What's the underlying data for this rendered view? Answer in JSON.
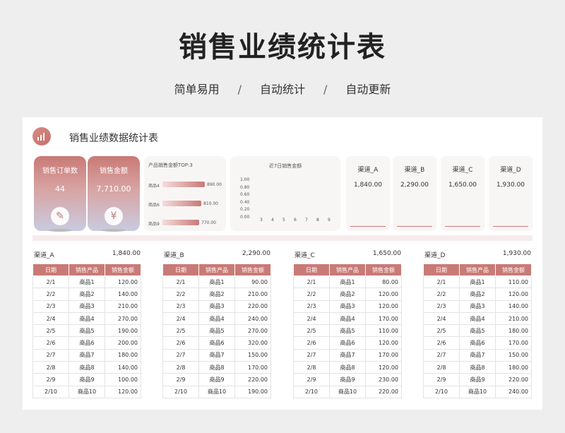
{
  "hero": {
    "title": "销售业绩统计表",
    "subtitle_parts": [
      "简单易用",
      "自动统计",
      "自动更新"
    ],
    "separator": "/"
  },
  "sheet": {
    "title": "销售业绩数据统计表"
  },
  "kpis": [
    {
      "label": "销售订单数",
      "value": "44",
      "icon": "edit-icon"
    },
    {
      "label": "销售金额",
      "value": "7,710.00",
      "icon": "yen-icon"
    }
  ],
  "top_products": {
    "title": "产品销售金额TOP:3",
    "rows": [
      {
        "name": "商品4",
        "value": 890,
        "label": "890.00"
      },
      {
        "name": "商品6",
        "value": 810,
        "label": "810.00"
      },
      {
        "name": "商品9",
        "value": 770,
        "label": "770.00"
      }
    ]
  },
  "recent_chart": {
    "title": "近7日销售金额",
    "y_ticks": [
      "1.00",
      "0.80",
      "0.60",
      "0.40",
      "0.20",
      "0.00"
    ],
    "x_ticks": [
      "3",
      "4",
      "5",
      "6",
      "7",
      "8",
      "9"
    ]
  },
  "channels": [
    {
      "name": "渠道_A",
      "value": "1,840.00"
    },
    {
      "name": "渠道_B",
      "value": "2,290.00"
    },
    {
      "name": "渠道_C",
      "value": "1,650.00"
    },
    {
      "name": "渠道_D",
      "value": "1,930.00"
    }
  ],
  "table_headers": [
    "日期",
    "销售产品",
    "销售金额"
  ],
  "tables": [
    {
      "name": "渠道_A",
      "total": "1,840.00",
      "rows": [
        [
          "2/1",
          "商品1",
          "120.00"
        ],
        [
          "2/2",
          "商品2",
          "140.00"
        ],
        [
          "2/3",
          "商品3",
          "210.00"
        ],
        [
          "2/4",
          "商品4",
          "270.00"
        ],
        [
          "2/5",
          "商品5",
          "190.00"
        ],
        [
          "2/6",
          "商品6",
          "200.00"
        ],
        [
          "2/7",
          "商品7",
          "180.00"
        ],
        [
          "2/8",
          "商品8",
          "140.00"
        ],
        [
          "2/9",
          "商品9",
          "100.00"
        ],
        [
          "2/10",
          "商品10",
          "120.00"
        ]
      ]
    },
    {
      "name": "渠道_B",
      "total": "2,290.00",
      "rows": [
        [
          "2/1",
          "商品1",
          "90.00"
        ],
        [
          "2/2",
          "商品2",
          "210.00"
        ],
        [
          "2/3",
          "商品3",
          "220.00"
        ],
        [
          "2/4",
          "商品4",
          "240.00"
        ],
        [
          "2/5",
          "商品5",
          "270.00"
        ],
        [
          "2/6",
          "商品6",
          "320.00"
        ],
        [
          "2/7",
          "商品7",
          "150.00"
        ],
        [
          "2/8",
          "商品8",
          "170.00"
        ],
        [
          "2/9",
          "商品9",
          "220.00"
        ],
        [
          "2/10",
          "商品10",
          "190.00"
        ]
      ]
    },
    {
      "name": "渠道_C",
      "total": "1,650.00",
      "rows": [
        [
          "2/1",
          "商品1",
          "80.00"
        ],
        [
          "2/2",
          "商品2",
          "120.00"
        ],
        [
          "2/3",
          "商品3",
          "120.00"
        ],
        [
          "2/4",
          "商品4",
          "170.00"
        ],
        [
          "2/5",
          "商品5",
          "110.00"
        ],
        [
          "2/6",
          "商品6",
          "120.00"
        ],
        [
          "2/7",
          "商品7",
          "170.00"
        ],
        [
          "2/8",
          "商品8",
          "120.00"
        ],
        [
          "2/9",
          "商品9",
          "230.00"
        ],
        [
          "2/10",
          "商品10",
          "220.00"
        ]
      ]
    },
    {
      "name": "渠道_D",
      "total": "1,930.00",
      "rows": [
        [
          "2/1",
          "商品1",
          "110.00"
        ],
        [
          "2/2",
          "商品2",
          "120.00"
        ],
        [
          "2/3",
          "商品3",
          "140.00"
        ],
        [
          "2/4",
          "商品4",
          "210.00"
        ],
        [
          "2/5",
          "商品5",
          "180.00"
        ],
        [
          "2/6",
          "商品6",
          "170.00"
        ],
        [
          "2/7",
          "商品7",
          "150.00"
        ],
        [
          "2/8",
          "商品8",
          "180.00"
        ],
        [
          "2/9",
          "商品9",
          "220.00"
        ],
        [
          "2/10",
          "商品10",
          "240.00"
        ]
      ]
    }
  ],
  "colors": {
    "accent": "#c97a76",
    "kpi_bottom": "#c9cbe0"
  }
}
